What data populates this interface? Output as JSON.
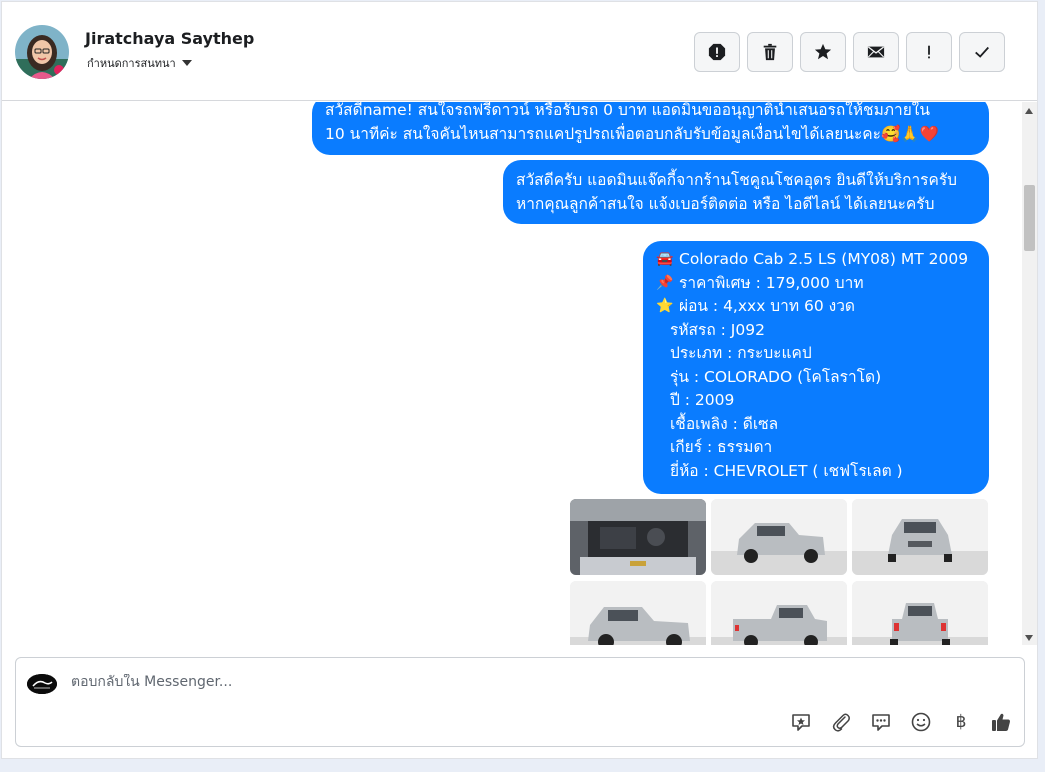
{
  "header": {
    "contact_name": "Jiratchaya Saythep",
    "assign_label": "กำหนดการสนทนา",
    "actions": [
      "spam-alert",
      "delete",
      "star",
      "email",
      "important",
      "done"
    ]
  },
  "messages": [
    {
      "lines": [
        "สวัสดีname! สนใจรถฟรีดาวน์ หรือรับรถ 0 บาท แอดมินขออนุญาตินำเสนอรถให้ชมภายใน",
        "10 นาทีค่ะ สนใจคันไหนสามารถแคปรูปรถเพื่อตอบกลับรับข้อมูลเงื่อนไขได้เลยนะคะ🥰🙏❤️"
      ]
    },
    {
      "lines": [
        "สวัสดีครับ แอดมินแจ๊คกี้จากร้านโชคูณโชคอุดร ยินดีให้บริการครับ",
        "หากคุณลูกค้าสนใจ แจ้งเบอร์ติดต่อ หรือ ไอดีไลน์ ได้เลยนะครับ"
      ]
    },
    {
      "title_emoji": "🚘",
      "title": "Colorado Cab 2.5 LS (MY08) MT 2009",
      "price_emoji": "📌",
      "price": "ราคาพิเศษ : 179,000 บาท",
      "installment_emoji": "⭐",
      "installment": "ผ่อน : 4,xxx บาท 60 งวด",
      "details": [
        "รหัสรถ : J092",
        "ประเภท : กระบะแคป",
        "รุ่น : COLORADO (โคโลราโด)",
        "ปี : 2009",
        "เชื้อเพลิง : ดีเซล",
        "เกียร์ : ธรรมดา",
        "ยี่ห้อ : CHEVROLET ( เชฟโรเลต )"
      ]
    }
  ],
  "photos": [
    "engine-bay",
    "front-left",
    "front",
    "side-left",
    "rear-left",
    "rear"
  ],
  "composer": {
    "placeholder": "ตอบกลับใน Messenger...",
    "baht_symbol": "฿"
  },
  "colors": {
    "bubble": "#0a7cff",
    "bubble_text": "#ffffff",
    "background": "#e9eef7"
  }
}
